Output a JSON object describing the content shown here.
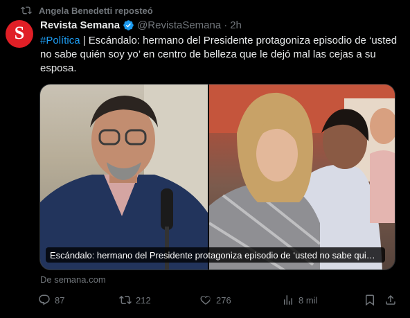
{
  "repost": {
    "text": "Angela Benedetti reposteó",
    "icon": "repost-icon"
  },
  "author": {
    "avatar_letter": "S",
    "avatar_color": "#e01f26",
    "name": "Revista Semana",
    "handle": "@RevistaSemana",
    "separator": "·",
    "time": "2h",
    "verified_color": "#1d9bf0"
  },
  "tweet": {
    "hashtag": "#Política",
    "text": " | Escándalo: hermano del Presidente protagoniza episodio de ‘usted no sabe quién soy yo’ en centro de belleza que le dejó mal las cejas a su esposa."
  },
  "card": {
    "caption": "Escándalo: hermano del Presidente protagoniza episodio de ‘usted no sabe qui…",
    "source": "De semana.com"
  },
  "actions": {
    "replies": "87",
    "reposts": "212",
    "likes": "276",
    "views": "8 mil"
  },
  "colors": {
    "background": "#000000",
    "text": "#e7e9ea",
    "muted": "#71767b",
    "link": "#1d9bf0"
  }
}
